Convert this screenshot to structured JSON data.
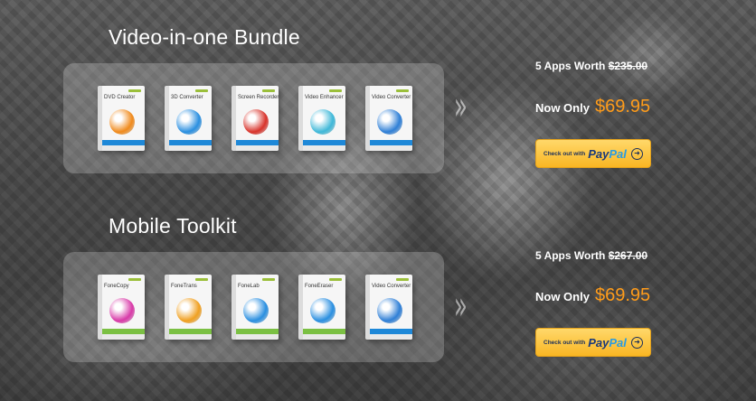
{
  "bundles": [
    {
      "title": "Video-in-one Bundle",
      "worth_prefix": "5 Apps Worth",
      "worth_price": "$235.00",
      "now_label": "Now Only",
      "now_price": "$69.95",
      "products": [
        {
          "name": "DVD Creator",
          "accent": "#f08a1c",
          "stripe": "#1e88d8"
        },
        {
          "name": "3D Converter",
          "accent": "#2a8fe0",
          "stripe": "#1e88d8"
        },
        {
          "name": "Screen Recorder",
          "accent": "#d8332b",
          "stripe": "#1e88d8"
        },
        {
          "name": "Video Enhancer",
          "accent": "#3fb8d8",
          "stripe": "#1e88d8"
        },
        {
          "name": "Video Converter",
          "accent": "#2f7fd6",
          "stripe": "#1e88d8"
        }
      ]
    },
    {
      "title": "Mobile Toolkit",
      "worth_prefix": "5 Apps Worth",
      "worth_price": "$267.00",
      "now_label": "Now Only",
      "now_price": "$69.95",
      "products": [
        {
          "name": "FoneCopy",
          "accent": "#d83aa8",
          "stripe": "#7bc043"
        },
        {
          "name": "FoneTrans",
          "accent": "#f0a021",
          "stripe": "#7bc043"
        },
        {
          "name": "FoneLab",
          "accent": "#2a8fe0",
          "stripe": "#7bc043"
        },
        {
          "name": "FoneEraser",
          "accent": "#2a8fe0",
          "stripe": "#7bc043"
        },
        {
          "name": "Video Converter",
          "accent": "#2f7fd6",
          "stripe": "#1e88d8"
        }
      ]
    }
  ],
  "paypal": {
    "checkout_text": "Check out with",
    "pay": "Pay",
    "pal": "Pal"
  },
  "icons": {
    "chevron": "chevron-right-icon",
    "arrow": "arrow-circle-icon"
  }
}
